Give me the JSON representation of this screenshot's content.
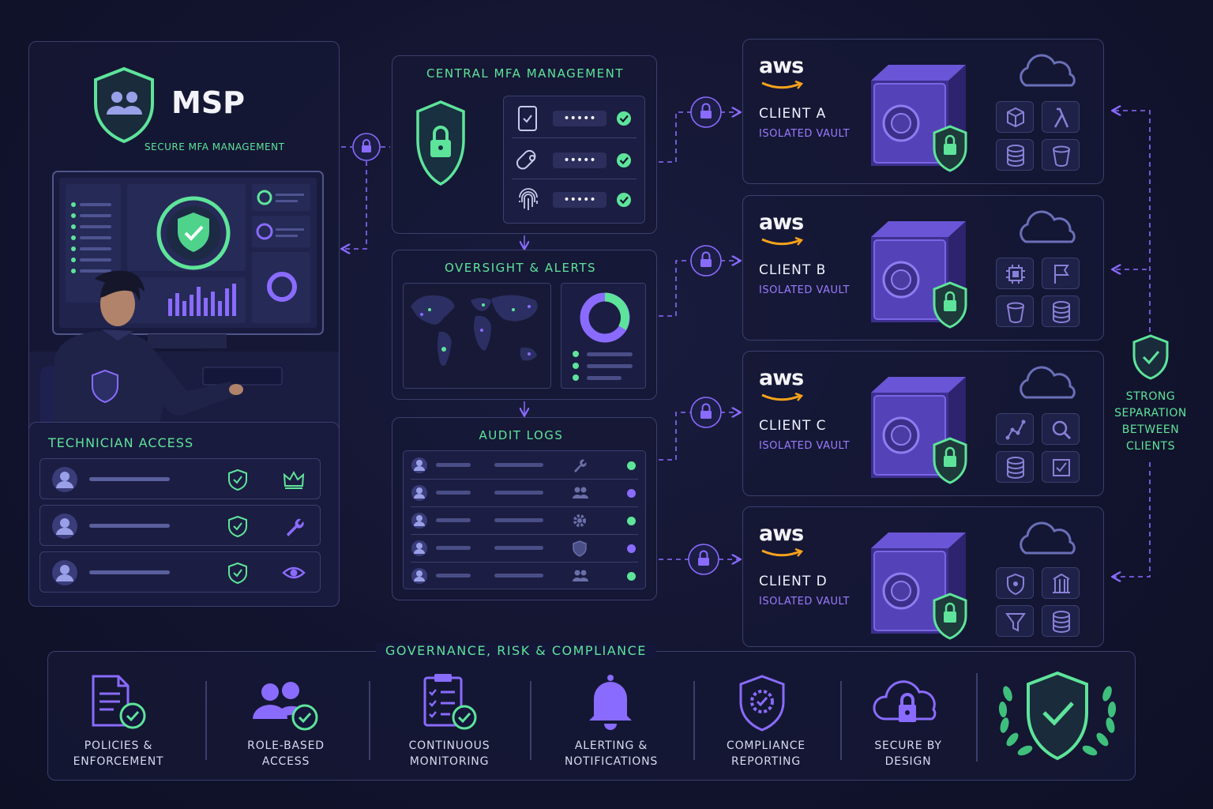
{
  "msp": {
    "title": "MSP",
    "subtitle": "SECURE MFA MANAGEMENT"
  },
  "technician": {
    "title": "TECHNICIAN ACCESS",
    "rows": [
      {
        "role_icon": "crown-icon"
      },
      {
        "role_icon": "wrench-icon"
      },
      {
        "role_icon": "eye-icon"
      }
    ]
  },
  "central_mfa": {
    "title": "CENTRAL MFA MANAGEMENT",
    "factors": [
      {
        "icon": "phone-icon",
        "code": "•••••"
      },
      {
        "icon": "key-fob-icon",
        "code": "•••••"
      },
      {
        "icon": "fingerprint-icon",
        "code": "•••••"
      }
    ]
  },
  "oversight": {
    "title": "OVERSIGHT & ALERTS"
  },
  "audit": {
    "title": "AUDIT LOGS",
    "rows": [
      {
        "icon": "wrench-icon",
        "status": "green"
      },
      {
        "icon": "users-icon",
        "status": "purple"
      },
      {
        "icon": "gear-icon",
        "status": "green"
      },
      {
        "icon": "shield-icon",
        "status": "purple"
      },
      {
        "icon": "users-icon",
        "status": "green"
      }
    ]
  },
  "clients": [
    {
      "brand": "aws",
      "name": "CLIENT A",
      "sub": "ISOLATED VAULT",
      "services": [
        "cube-icon",
        "lambda-icon",
        "database-icon",
        "bucket-icon"
      ]
    },
    {
      "brand": "aws",
      "name": "CLIENT B",
      "sub": "ISOLATED VAULT",
      "services": [
        "chip-icon",
        "flag-icon",
        "bucket-icon",
        "database-icon"
      ]
    },
    {
      "brand": "aws",
      "name": "CLIENT C",
      "sub": "ISOLATED VAULT",
      "services": [
        "graph-icon",
        "search-icon",
        "database-icon",
        "checklist-icon"
      ]
    },
    {
      "brand": "aws",
      "name": "CLIENT D",
      "sub": "ISOLATED VAULT",
      "services": [
        "shield-icon",
        "columns-icon",
        "filter-icon",
        "database-icon"
      ]
    }
  ],
  "separation": {
    "line1": "STRONG",
    "line2": "SEPARATION",
    "line3": "BETWEEN",
    "line4": "CLIENTS"
  },
  "grc": {
    "title": "GOVERNANCE, RISK & COMPLIANCE",
    "items": [
      {
        "icon": "policy-document-icon",
        "line1": "POLICIES &",
        "line2": "ENFORCEMENT"
      },
      {
        "icon": "role-users-icon",
        "line1": "ROLE-BASED",
        "line2": "ACCESS"
      },
      {
        "icon": "clipboard-icon",
        "line1": "CONTINUOUS",
        "line2": "MONITORING"
      },
      {
        "icon": "bell-icon",
        "line1": "ALERTING &",
        "line2": "NOTIFICATIONS"
      },
      {
        "icon": "compliance-shield-icon",
        "line1": "COMPLIANCE",
        "line2": "REPORTING"
      },
      {
        "icon": "cloud-lock-icon",
        "line1": "SECURE BY",
        "line2": "DESIGN"
      }
    ]
  },
  "colors": {
    "green": "#5ee49a",
    "purple": "#8a6bff",
    "background": "#12142e",
    "panel_border": "#3b3f6e"
  }
}
